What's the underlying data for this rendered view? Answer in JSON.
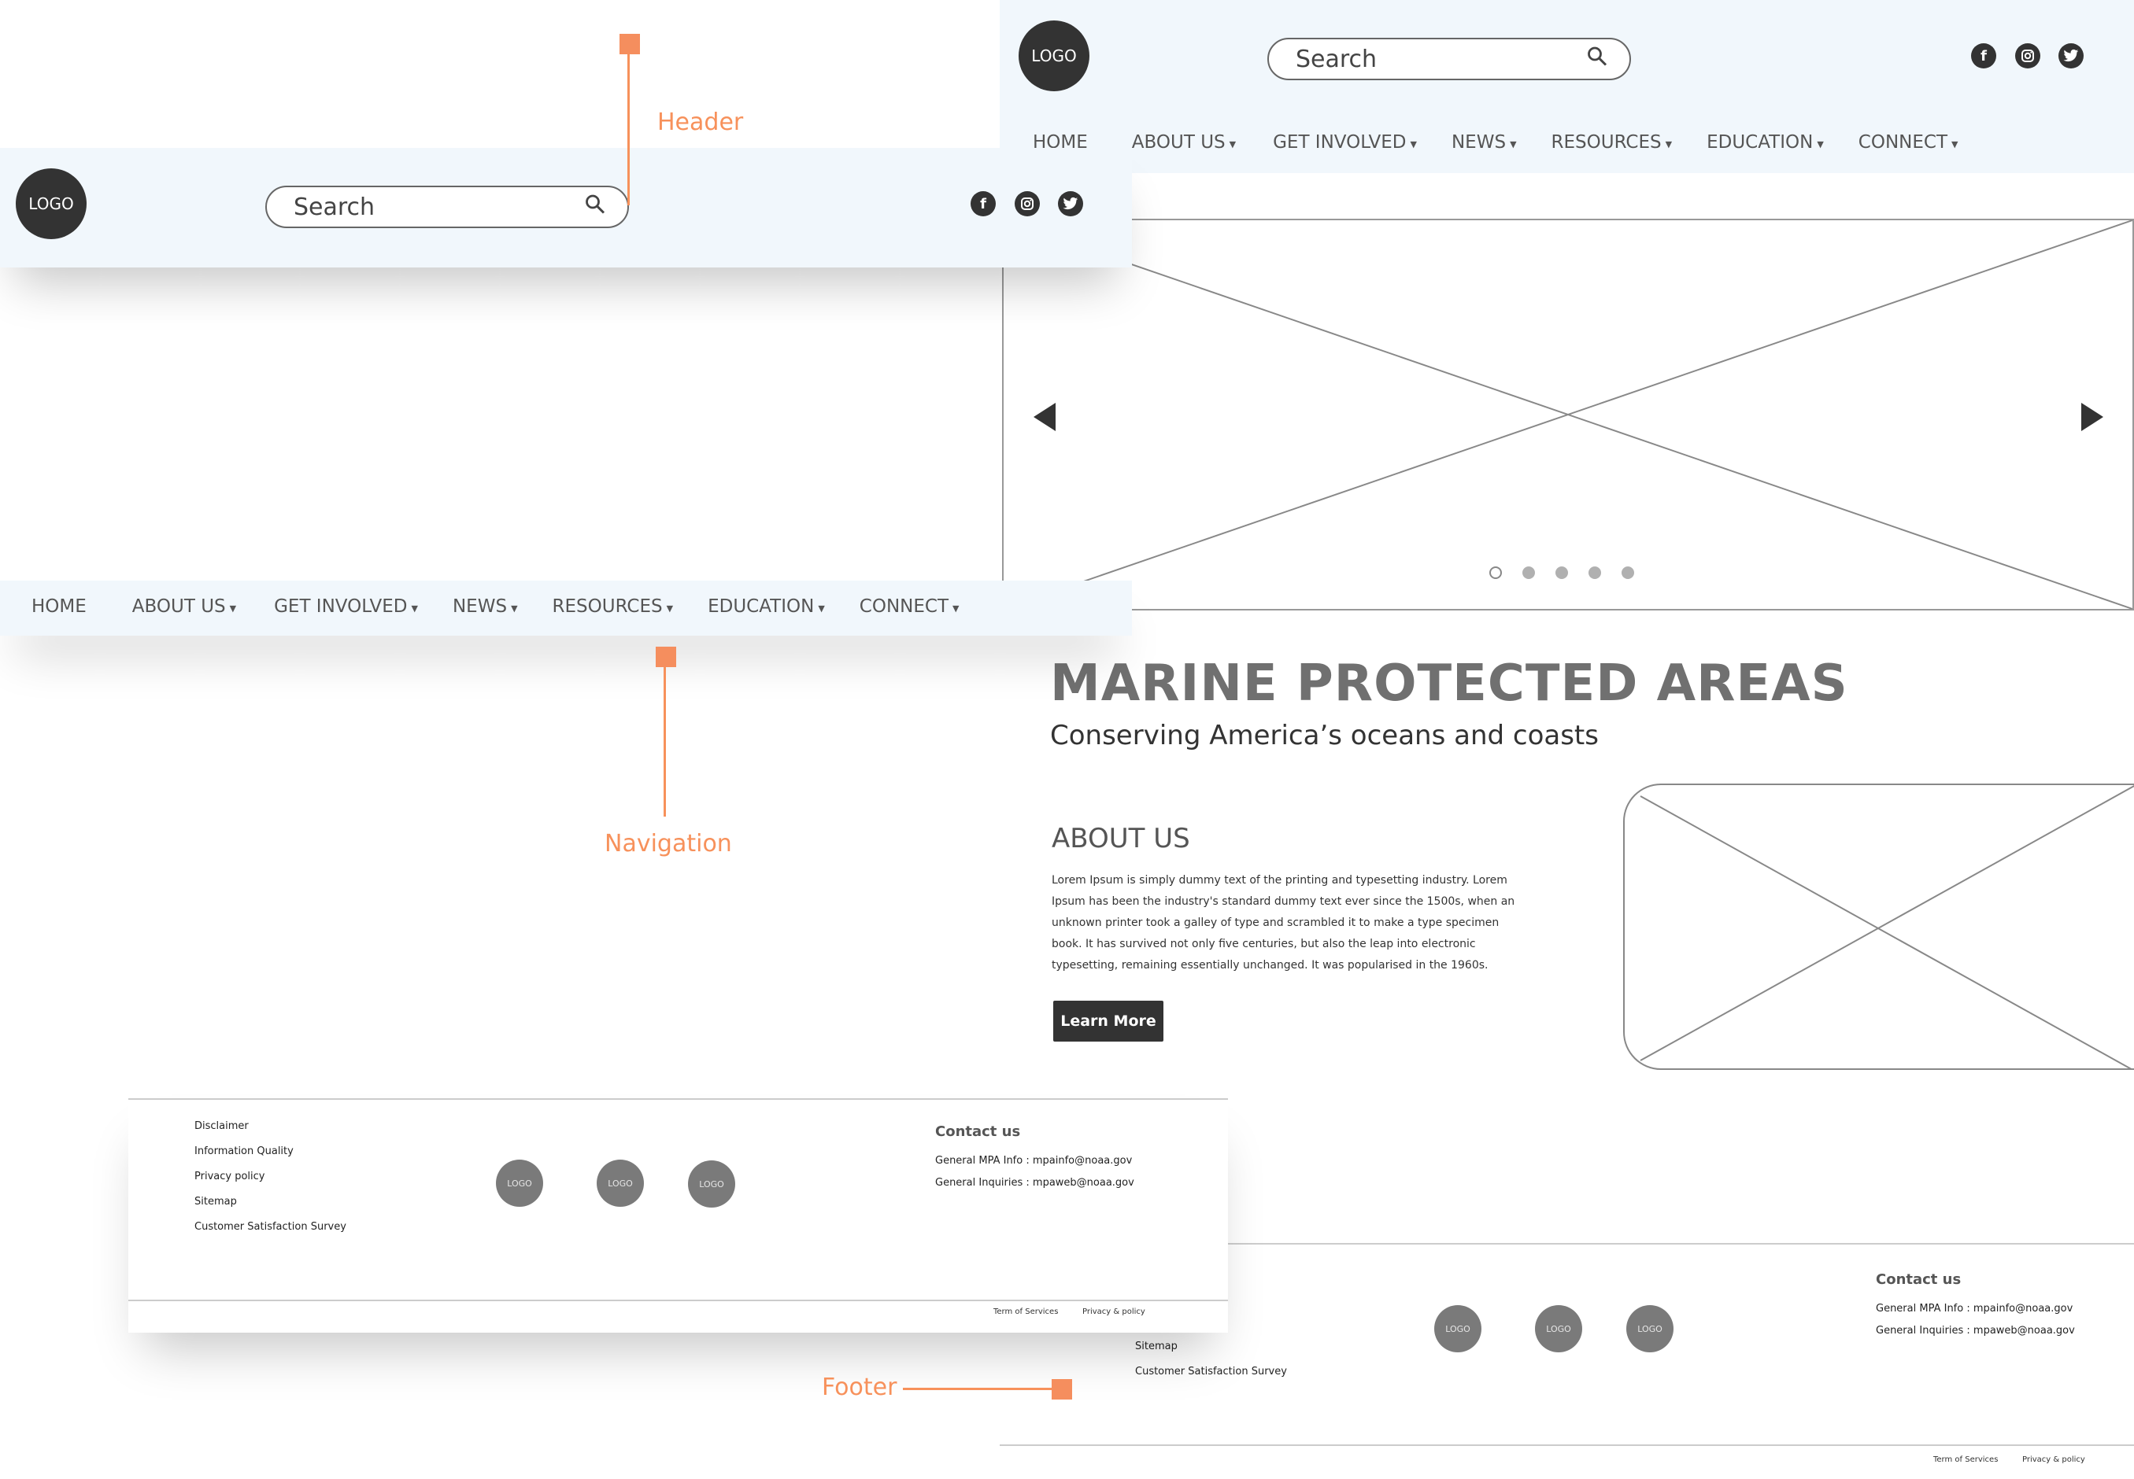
{
  "annotations": {
    "header": "Header",
    "navigation": "Navigation",
    "footer": "Footer"
  },
  "header": {
    "logo": "LOGO",
    "search_placeholder": "Search",
    "social_icons": [
      "facebook-icon",
      "instagram-icon",
      "twitter-icon"
    ]
  },
  "nav": {
    "items": [
      {
        "label": "HOME",
        "caret": false
      },
      {
        "label": "ABOUT US",
        "caret": true
      },
      {
        "label": "GET INVOLVED",
        "caret": true
      },
      {
        "label": "NEWS",
        "caret": true
      },
      {
        "label": "RESOURCES",
        "caret": true
      },
      {
        "label": "EDUCATION",
        "caret": true
      },
      {
        "label": "CONNECT",
        "caret": true
      }
    ]
  },
  "hero": {
    "title": "MARINE PROTECTED AREAS",
    "subtitle": "Conserving America’s oceans and coasts",
    "slide_count": 5,
    "active_slide": 1
  },
  "about": {
    "heading": "ABOUT US",
    "body_lines": [
      "Lorem Ipsum is simply dummy text of the printing and typesetting industry. Lorem",
      "Ipsum has been the industry's standard dummy text ever since the 1500s, when an",
      "unknown printer took a galley of type and scrambled it to make a type specimen",
      "book. It has survived not only five centuries, but also the leap into electronic",
      "typesetting, remaining essentially unchanged. It was popularised in the 1960s."
    ],
    "button": "Learn More"
  },
  "footer": {
    "links": [
      "Disclaimer",
      "Information Quality",
      "Privacy policy",
      "Sitemap",
      "Customer Satisfaction Survey"
    ],
    "logo": "LOGO",
    "contact_title": "Contact us",
    "contact_lines": [
      "General MPA Info : mpainfo@noaa.gov",
      "General Inquiries : mpaweb@noaa.gov"
    ],
    "bottom_links": [
      "Term of Services",
      "Privacy & policy"
    ]
  },
  "colors": {
    "accent": "#f58e5e",
    "header_bg": "#f1f7fc",
    "dark": "#333333",
    "grey_logo": "#7a7a7a"
  }
}
